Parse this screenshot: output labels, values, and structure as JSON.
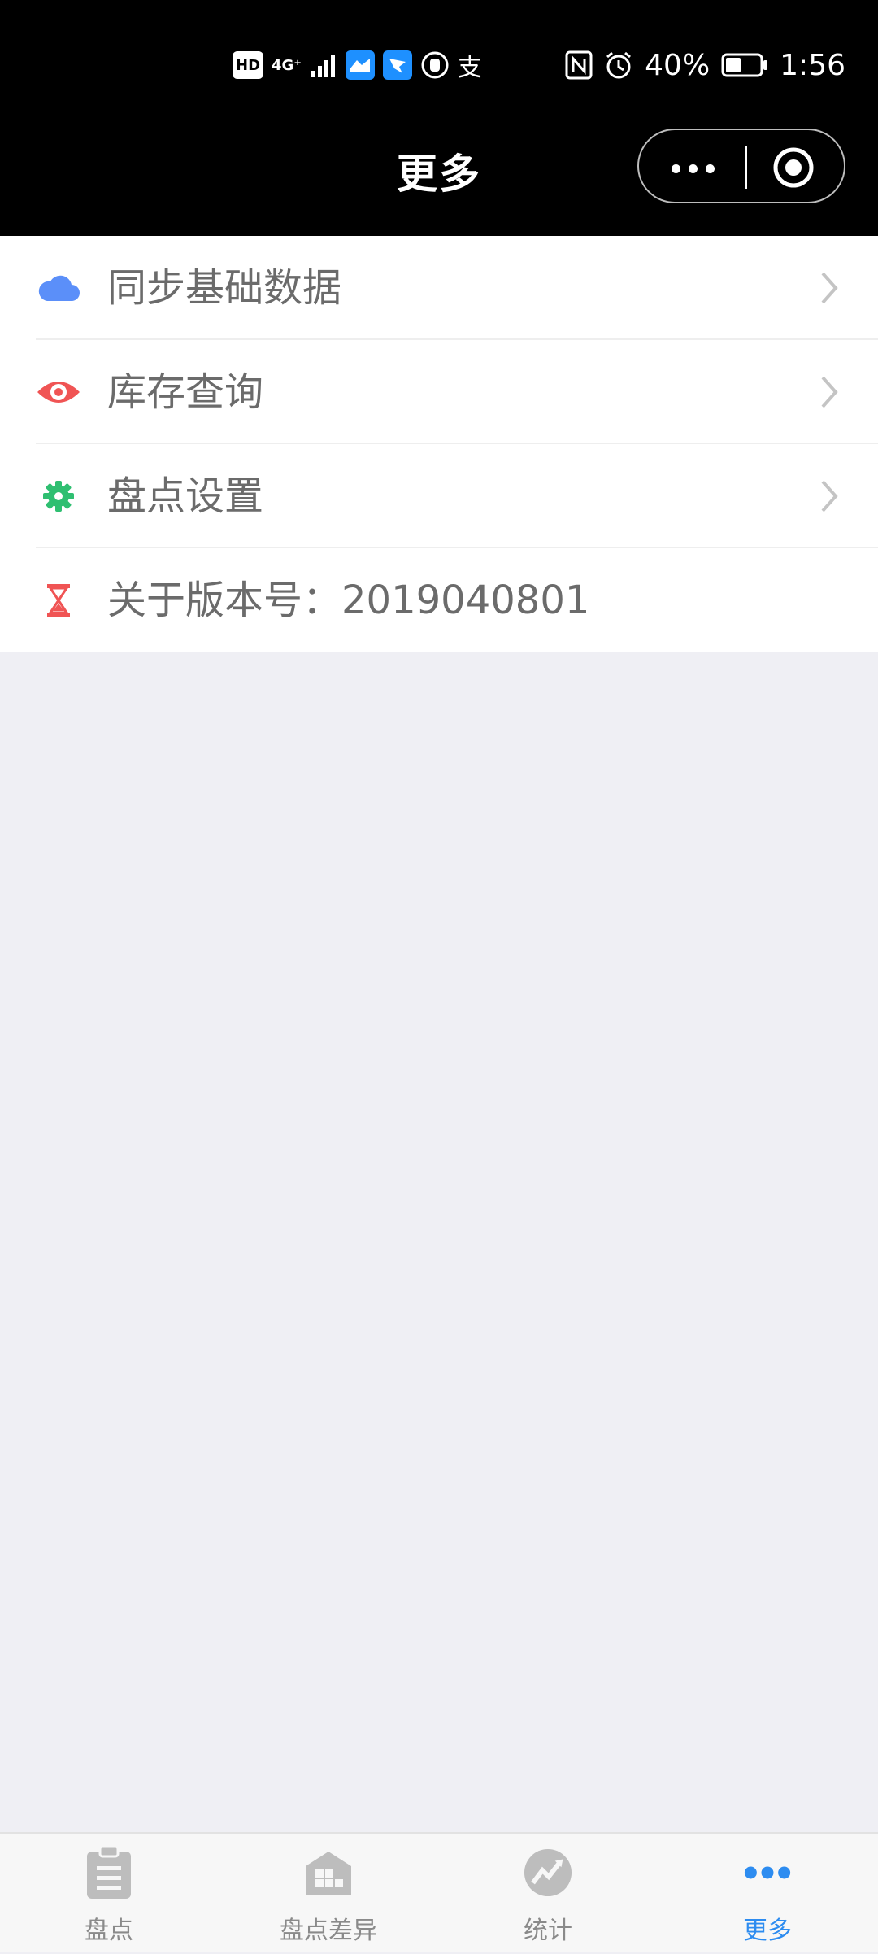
{
  "status_bar": {
    "left_chips": [
      "HD",
      "4G⁺"
    ],
    "zhifubao_glyph": "支",
    "battery_percent": "40%",
    "time": "1:56"
  },
  "navbar": {
    "title": "更多"
  },
  "menu": {
    "items": [
      {
        "label": "同步基础数据",
        "icon": "cloud-icon",
        "color": "#5b8ff9"
      },
      {
        "label": "库存查询",
        "icon": "eye-icon",
        "color": "#f05454"
      },
      {
        "label": "盘点设置",
        "icon": "gear-icon",
        "color": "#2fbf71"
      },
      {
        "label": "关于版本号：2019040801",
        "icon": "hourglass-icon",
        "color": "#f05454"
      }
    ]
  },
  "tabbar": {
    "tabs": [
      {
        "label": "盘点",
        "icon": "clipboard-icon"
      },
      {
        "label": "盘点差异",
        "icon": "warehouse-icon"
      },
      {
        "label": "统计",
        "icon": "trend-icon"
      },
      {
        "label": "更多",
        "icon": "more-dots-icon",
        "active": true
      }
    ],
    "active_color": "#2d8cf0",
    "inactive_color": "#8a8a8a"
  }
}
